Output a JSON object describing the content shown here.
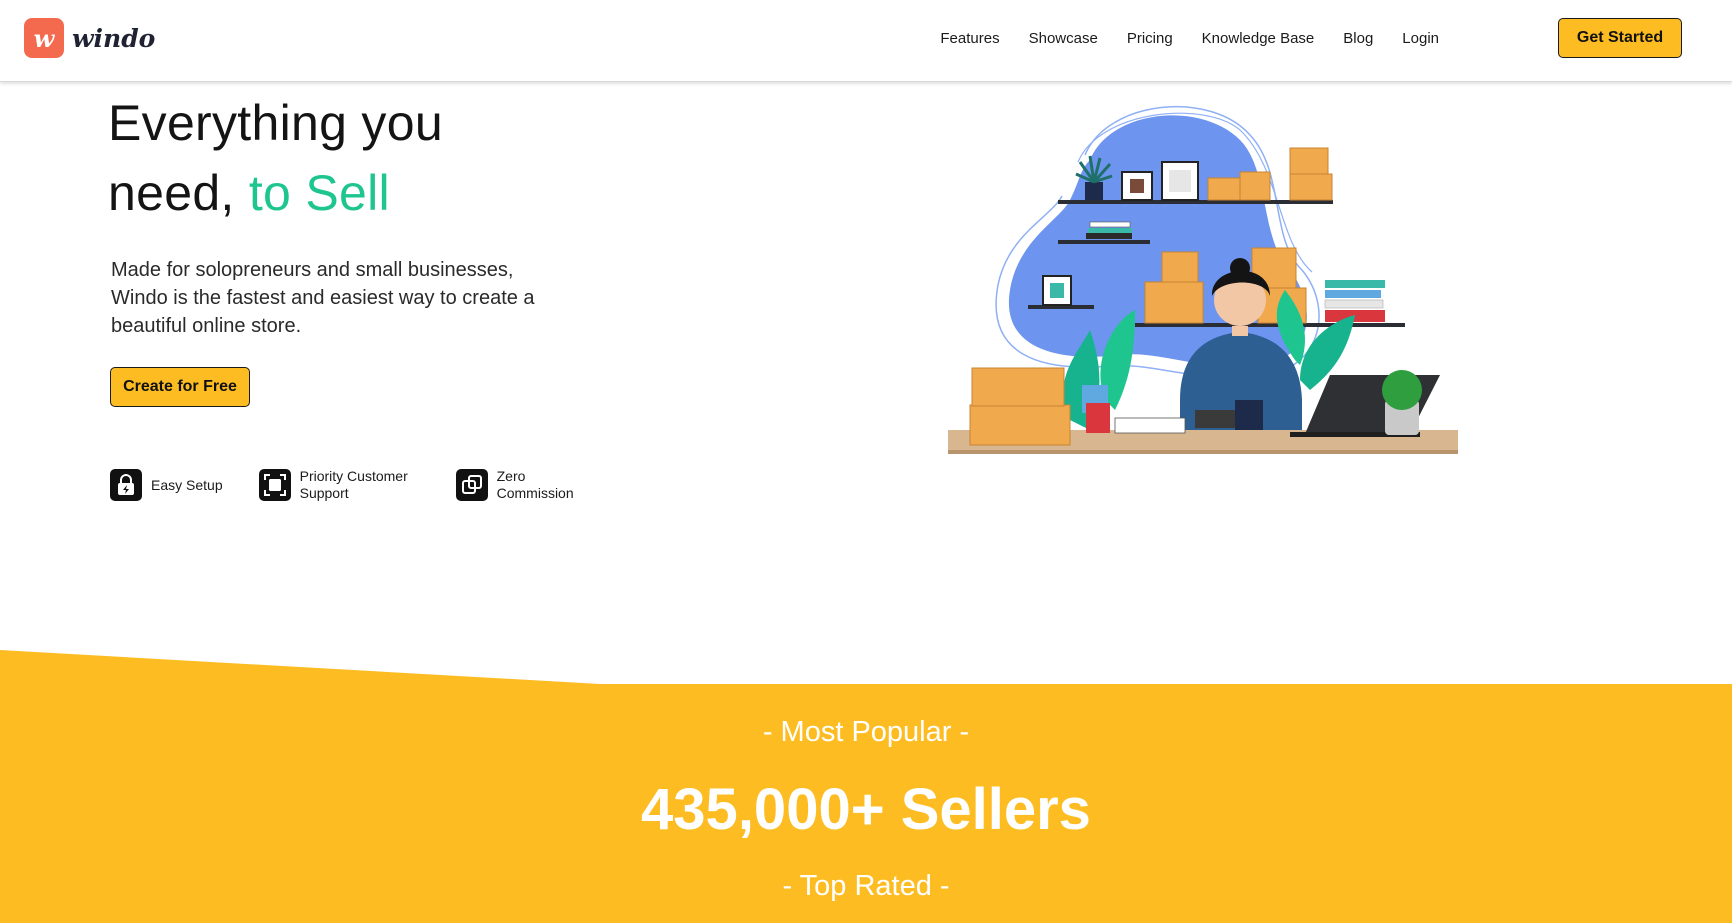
{
  "brand": {
    "logo_letter": "w",
    "name": "windo",
    "color": "#f46a4e"
  },
  "nav": {
    "items": [
      "Features",
      "Showcase",
      "Pricing",
      "Knowledge Base",
      "Blog",
      "Login"
    ],
    "cta_label": "Get Started"
  },
  "hero": {
    "title_line1": "Everything you",
    "title_line2_plain": "need, ",
    "title_line2_accent": "to Sell",
    "subtitle": "Made for solopreneurs and small businesses, Windo is the fastest and easiest way to create a beautiful online store.",
    "cta_label": "Create for Free",
    "features": [
      {
        "icon": "lock-bolt-icon",
        "label": "Easy Setup"
      },
      {
        "icon": "support-frame-icon",
        "label": "Priority Customer Support"
      },
      {
        "icon": "overlap-squares-icon",
        "label": "Zero Commission"
      }
    ]
  },
  "stats": {
    "popular_label": "- Most Popular -",
    "sellers_label": "435,000+ Sellers",
    "rated_label": "- Top Rated  -"
  },
  "colors": {
    "accent_yellow": "#fdbd22",
    "accent_green": "#1fc58f",
    "band_yellow": "#fdbd22"
  }
}
